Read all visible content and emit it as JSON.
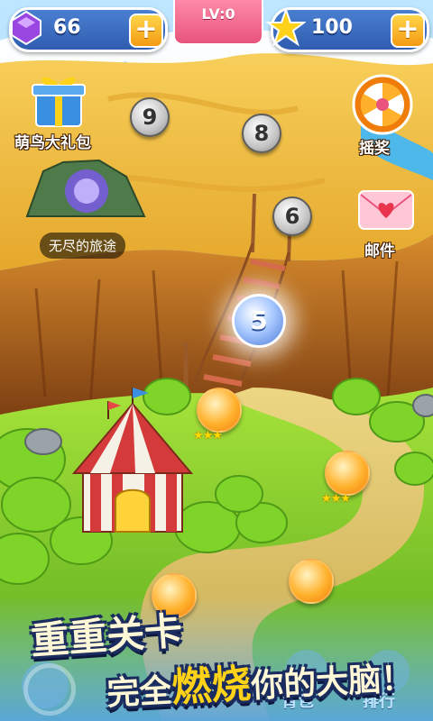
{
  "topbar": {
    "gems": "66",
    "level": "LV:0",
    "stars": "100",
    "plus_label": "+"
  },
  "left_panel": {
    "gift_label": "萌鸟大礼包",
    "endless_label": "无尽的旅途"
  },
  "right_panel": {
    "lottery_label": "摇奖",
    "mail_label": "邮件"
  },
  "levels": {
    "n9": "9",
    "n8": "8",
    "n6": "6",
    "n5": "5"
  },
  "promo": {
    "line1": "重重关卡",
    "line2_a": "完全",
    "line2_b": "燃烧",
    "line2_c": "你的大脑！"
  },
  "bottom": {
    "bag_label": "背包",
    "rank_label": "排行"
  },
  "colors": {
    "topbar_pill": "#2f5db0",
    "level_banner": "#e8547c",
    "plus_button": "#f39a12",
    "sand": "#f2bd3a",
    "grass": "#7ccc2a",
    "node_current": "#4c7ad6",
    "node_done": "#ffb12c"
  }
}
